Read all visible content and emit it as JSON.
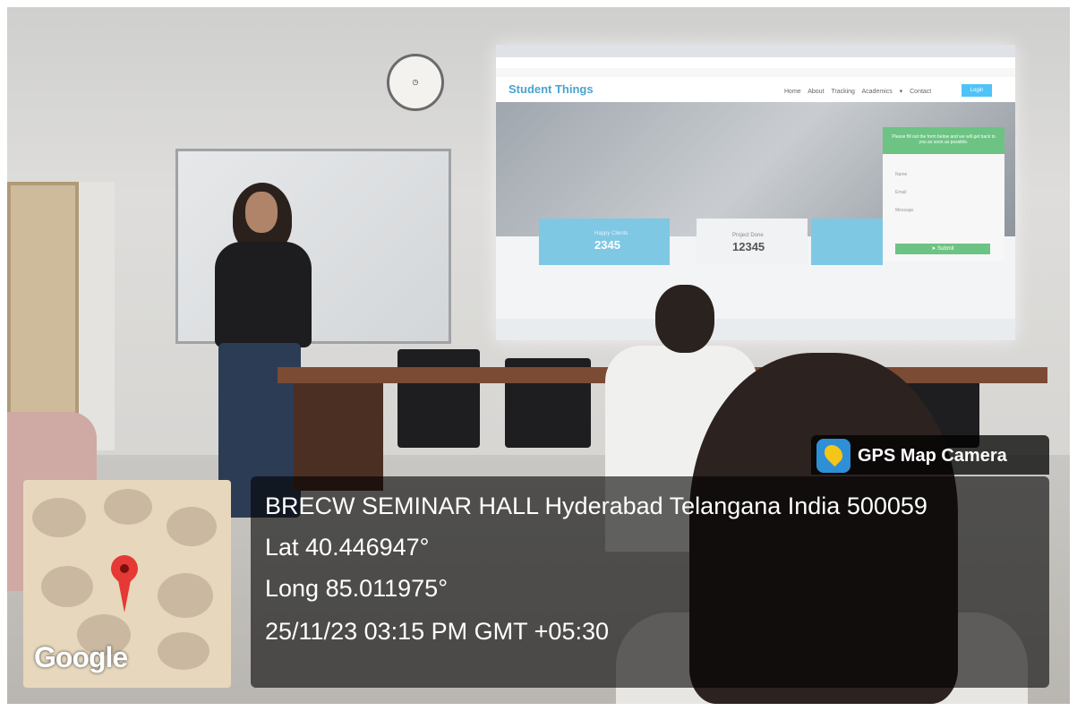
{
  "overlay": {
    "badge": "GPS Map Camera",
    "location": "BRECW SEMINAR HALL Hyderabad Telangana India 500059",
    "latitude": "Lat 40.446947°",
    "longitude": "Long 85.011975°",
    "datetime": "25/11/23 03:15 PM GMT +05:30"
  },
  "map": {
    "attribution": "Google",
    "pin": "location-pin-icon"
  },
  "projection": {
    "site_title": "Student Things",
    "menu": "Home About Tracking Academics ▾ Contact",
    "login": "Login",
    "stats": [
      {
        "label": "Happy Clients",
        "value": "2345"
      },
      {
        "label": "Project Done",
        "value": "12345"
      }
    ],
    "form": {
      "intro": "Please fill out the form below and we will get back to you as soon as possible.",
      "name": "Name",
      "email": "Email",
      "message": "Message",
      "submit": "➤ Submit"
    }
  },
  "colors": {
    "overlay_bg": "#000000",
    "pin": "#e53935",
    "projector_accent": "#4aa3cf",
    "form_green": "#6cc383"
  }
}
